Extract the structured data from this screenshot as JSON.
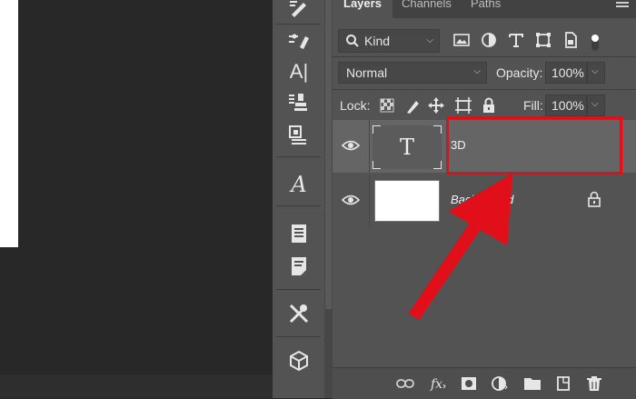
{
  "panel": {
    "tabs": [
      {
        "label": "Layers",
        "active": true
      },
      {
        "label": "Channels",
        "active": false
      },
      {
        "label": "Paths",
        "active": false
      }
    ]
  },
  "filter": {
    "kind_label": "Kind",
    "icons": [
      "image-filter-icon",
      "adjustment-filter-icon",
      "type-filter-icon",
      "shape-filter-icon",
      "smart-object-filter-icon"
    ]
  },
  "blend": {
    "mode": "Normal",
    "opacity_label": "Opacity:",
    "opacity_value": "100%"
  },
  "lock": {
    "label": "Lock:",
    "fill_label": "Fill:",
    "fill_value": "100%"
  },
  "layers": [
    {
      "name": "3D",
      "type": "text",
      "selected": true,
      "visible": true
    },
    {
      "name": "Background",
      "type": "image",
      "selected": false,
      "visible": true,
      "locked": true
    }
  ],
  "colors": {
    "highlight": "#e00f19",
    "panel_bg": "#535353",
    "selected_row": "#656565"
  }
}
